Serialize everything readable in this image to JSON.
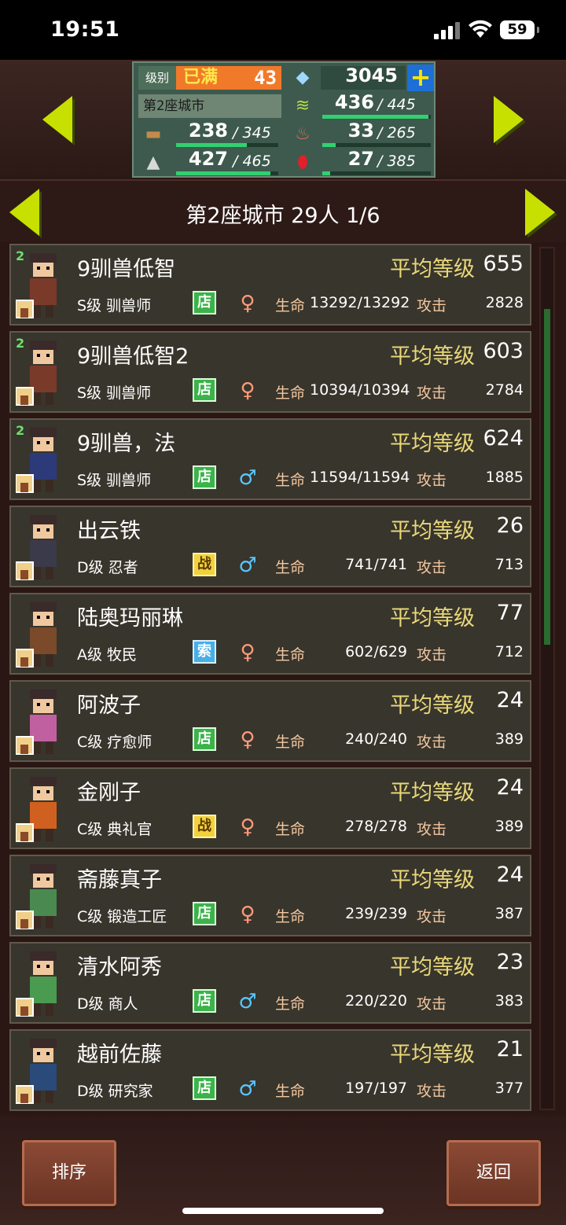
{
  "status_bar": {
    "time": "19:51",
    "battery": "59"
  },
  "resources": {
    "level_label": "级别",
    "level_full": "已满",
    "level_value": "43",
    "gems": "3045",
    "city_name": "第2座城市",
    "grain": {
      "value": "436",
      "max": "/ 445",
      "fill": 0.98
    },
    "wood": {
      "value": "238",
      "max": "/ 345",
      "fill": 0.69
    },
    "food": {
      "value": "33",
      "max": "/ 265",
      "fill": 0.12
    },
    "ore": {
      "value": "427",
      "max": "/ 465",
      "fill": 0.92
    },
    "crystal": {
      "value": "27",
      "max": "/ 385",
      "fill": 0.07
    }
  },
  "title": "第2座城市  29人 1/6",
  "labels": {
    "avg_level": "平均等级",
    "hp": "生命",
    "atk": "攻击"
  },
  "residents": [
    {
      "name": "9驯兽低智",
      "level": "655",
      "class": "S级 驯兽师",
      "tag": "店",
      "tag_type": "shop",
      "gender": "♀",
      "gender_type": "f",
      "hp": "13292/13292",
      "atk": "2828",
      "badge": "2",
      "avatar_color": "#7a3a2a"
    },
    {
      "name": "9驯兽低智2",
      "level": "603",
      "class": "S级 驯兽师",
      "tag": "店",
      "tag_type": "shop",
      "gender": "♀",
      "gender_type": "f",
      "hp": "10394/10394",
      "atk": "2784",
      "badge": "2",
      "avatar_color": "#7a3a2a"
    },
    {
      "name": "9驯兽，法",
      "level": "624",
      "class": "S级 驯兽师",
      "tag": "店",
      "tag_type": "shop",
      "gender": "♂",
      "gender_type": "m",
      "hp": "11594/11594",
      "atk": "1885",
      "badge": "2",
      "avatar_color": "#2c3a7a"
    },
    {
      "name": "出云铁",
      "level": "26",
      "class": "D级 忍者",
      "tag": "战",
      "tag_type": "war",
      "gender": "♂",
      "gender_type": "m",
      "hp": "741/741",
      "atk": "713",
      "badge": "",
      "avatar_color": "#3a3a4a"
    },
    {
      "name": "陆奥玛丽琳",
      "level": "77",
      "class": "A级 牧民",
      "tag": "索",
      "tag_type": "explore",
      "gender": "♀",
      "gender_type": "f",
      "hp": "602/629",
      "atk": "712",
      "badge": "",
      "avatar_color": "#7a4a2a"
    },
    {
      "name": "阿波子",
      "level": "24",
      "class": "C级 疗愈师",
      "tag": "店",
      "tag_type": "shop",
      "gender": "♀",
      "gender_type": "f",
      "hp": "240/240",
      "atk": "389",
      "badge": "",
      "avatar_color": "#c060a0"
    },
    {
      "name": "金刚子",
      "level": "24",
      "class": "C级 典礼官",
      "tag": "战",
      "tag_type": "war",
      "gender": "♀",
      "gender_type": "f",
      "hp": "278/278",
      "atk": "389",
      "badge": "",
      "avatar_color": "#d06020"
    },
    {
      "name": "斋藤真子",
      "level": "24",
      "class": "C级 锻造工匠",
      "tag": "店",
      "tag_type": "shop",
      "gender": "♀",
      "gender_type": "f",
      "hp": "239/239",
      "atk": "387",
      "badge": "",
      "avatar_color": "#4a8a50"
    },
    {
      "name": "清水阿秀",
      "level": "23",
      "class": "D级 商人",
      "tag": "店",
      "tag_type": "shop",
      "gender": "♂",
      "gender_type": "m",
      "hp": "220/220",
      "atk": "383",
      "badge": "",
      "avatar_color": "#4a9a50"
    },
    {
      "name": "越前佐藤",
      "level": "21",
      "class": "D级 研究家",
      "tag": "店",
      "tag_type": "shop",
      "gender": "♂",
      "gender_type": "m",
      "hp": "197/197",
      "atk": "377",
      "badge": "",
      "avatar_color": "#2a4a7a"
    }
  ],
  "buttons": {
    "sort": "排序",
    "back": "返回"
  },
  "colors": {
    "accent_arrow": "#c8e000",
    "avg_label": "#e8d77a",
    "shop": "#3bb34a",
    "war": "#f2d23c",
    "explore": "#49aee8"
  },
  "scroll": {
    "position": 0.07,
    "visible": 0.39
  }
}
